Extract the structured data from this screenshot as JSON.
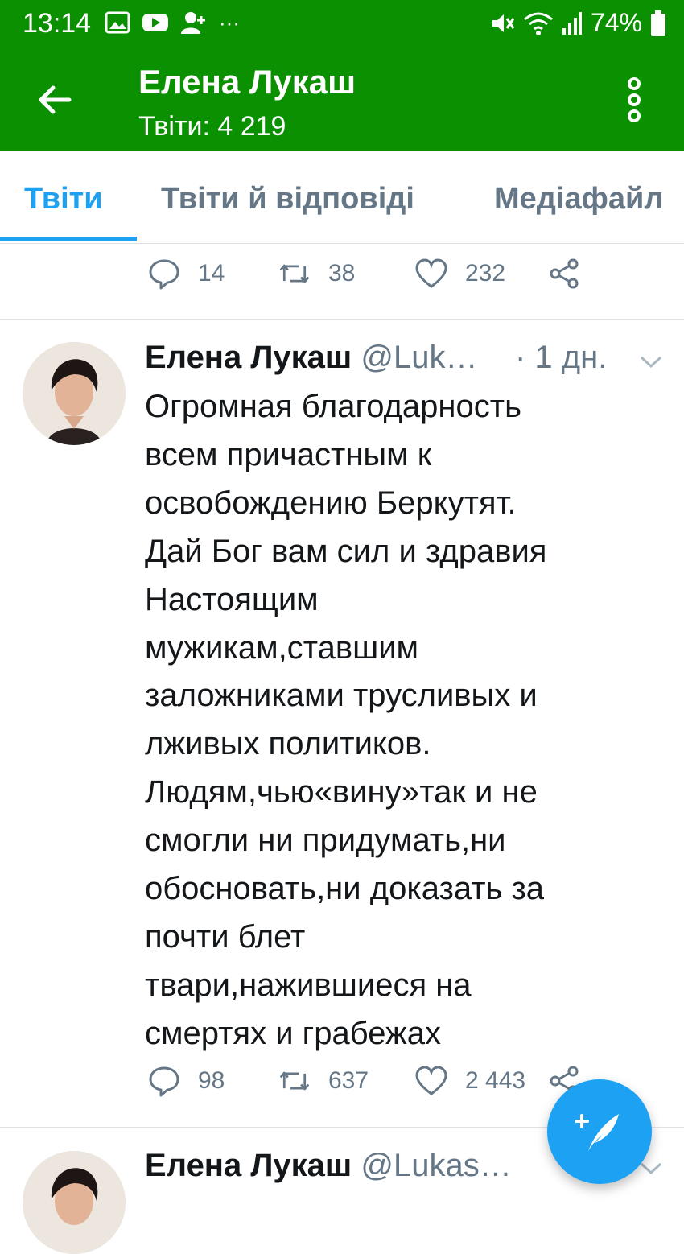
{
  "status_bar": {
    "time": "13:14",
    "battery": "74%",
    "more_dots": "···"
  },
  "app_bar": {
    "title": "Елена Лукаш",
    "subtitle": "Твіти: 4 219"
  },
  "tabs": [
    {
      "label": "Твіти",
      "active": true
    },
    {
      "label": "Твіти й відповіді",
      "active": false
    },
    {
      "label": "Медіафайл",
      "active": false
    }
  ],
  "prev_tweet_actions": {
    "replies": "14",
    "retweets": "38",
    "likes": "232"
  },
  "tweet": {
    "name": "Елена Лукаш",
    "handle": "@Luk…",
    "time": "· 1 дн.",
    "lines": [
      "Огромная благодарность",
      "всем причастным к",
      "освобождению Беркутят.",
      "Дай Бог вам сил и здравия",
      "Настоящим",
      "мужикам,ставшим",
      "заложниками трусливых и",
      "лживых политиков.",
      "Людям,чью«вину»так и не",
      "смогли ни придумать,ни",
      "обосновать,ни доказать за",
      "почти блет",
      "твари,нажившиеся на",
      "смертях и грабежах"
    ],
    "replies": "98",
    "retweets": "637",
    "likes": "2 443"
  },
  "next_tweet": {
    "name": "Елена Лукаш",
    "handle": "@Lukas…"
  },
  "colors": {
    "bar_green": "#0a9000",
    "twitter_blue": "#1da1f2",
    "muted_gray": "#657786"
  }
}
